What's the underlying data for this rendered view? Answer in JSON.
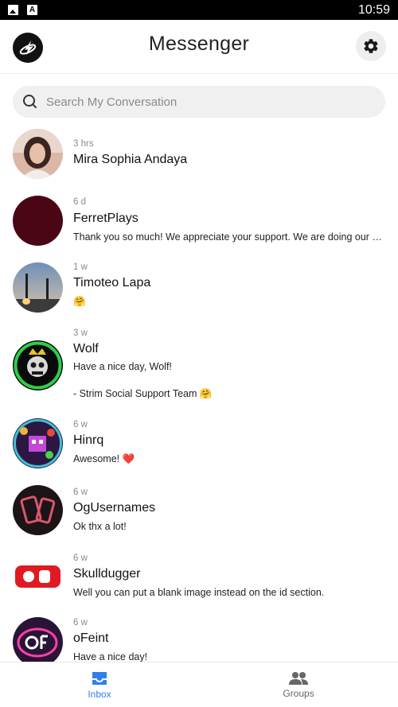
{
  "status_bar": {
    "time": "10:59",
    "icons": [
      "image-notification-icon",
      "a-notification-icon"
    ]
  },
  "header": {
    "title": "Messenger",
    "logo_icon": "app-logo-icon",
    "settings_icon": "gear-icon"
  },
  "search": {
    "placeholder": "Search My Conversation",
    "icon": "search-icon"
  },
  "conversations": [
    {
      "time": "3 hrs",
      "name": "Mira Sophia Andaya",
      "message": ""
    },
    {
      "time": "6 d",
      "name": "FerretPlays",
      "message": "Thank you so much! We appreciate your support. We are doing our b..."
    },
    {
      "time": "1 w",
      "name": "Timoteo Lapa",
      "message": "🤗"
    },
    {
      "time": "3 w",
      "name": "Wolf",
      "message": "Have a nice day, Wolf!\n\n- Strim Social Support Team 🤗"
    },
    {
      "time": "6 w",
      "name": "Hinrq",
      "message": "Awesome! ❤️"
    },
    {
      "time": "6 w",
      "name": "OgUsernames",
      "message": "Ok thx a lot!"
    },
    {
      "time": "6 w",
      "name": "Skulldugger",
      "message": "Well you can put a blank image instead on the id section."
    },
    {
      "time": "6 w",
      "name": "oFeint",
      "message": "Have a nice day!"
    }
  ],
  "bottom_nav": {
    "items": [
      {
        "label": "Inbox",
        "icon": "inbox-icon",
        "active": true
      },
      {
        "label": "Groups",
        "icon": "groups-icon",
        "active": false
      }
    ]
  },
  "colors": {
    "accent": "#2f80ed",
    "inactive": "#666666",
    "text": "#111111",
    "muted": "#8a8a8a"
  }
}
